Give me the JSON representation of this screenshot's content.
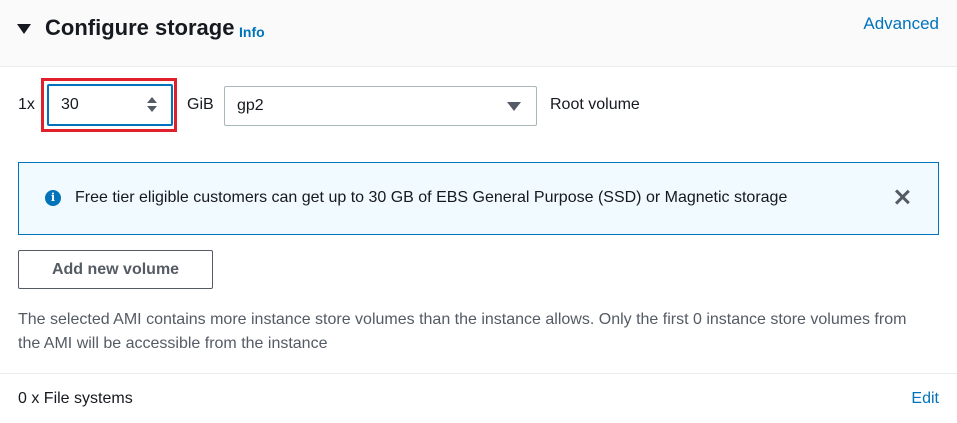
{
  "header": {
    "title": "Configure storage",
    "info_label": "Info",
    "advanced_label": "Advanced"
  },
  "volume_row": {
    "multiplier": "1x",
    "size_value": "30",
    "size_unit": "GiB",
    "volume_type": "gp2",
    "volume_label": "Root volume"
  },
  "alert": {
    "icon": "info-icon",
    "message": "Free tier eligible customers can get up to 30 GB of EBS General Purpose (SSD) or Magnetic storage"
  },
  "add_volume_label": "Add new volume",
  "notice": "The selected AMI contains more instance store volumes than the instance allows. Only the first 0 instance store volumes from the AMI will be accessible from the instance",
  "file_systems": {
    "label": "0 x File systems",
    "edit_label": "Edit"
  },
  "colors": {
    "link": "#0073bb",
    "highlight": "#e0202a",
    "alert_bg": "#f1faff"
  }
}
